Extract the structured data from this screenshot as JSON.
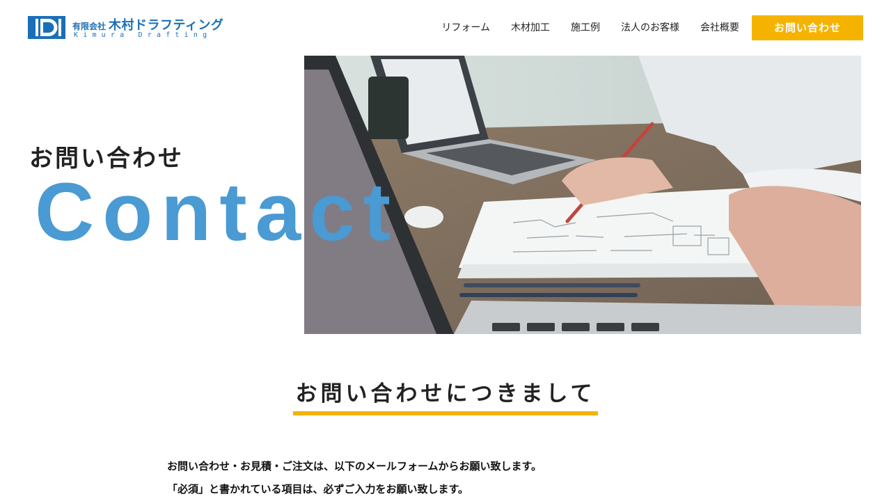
{
  "brand": {
    "company_prefix": "有限会社",
    "company_name": "木村ドラフティング",
    "company_en": "Kimura Drafting",
    "logo_icon": "kd-logo-mark",
    "color": "#1a6fb8"
  },
  "nav": {
    "items": [
      {
        "label": "リフォーム"
      },
      {
        "label": "木材加工"
      },
      {
        "label": "施工例"
      },
      {
        "label": "法人のお客様"
      },
      {
        "label": "会社概要"
      }
    ],
    "cta_label": "お問い合わせ"
  },
  "hero": {
    "subtitle": "お問い合わせ",
    "title": "Contact",
    "image": "office-desk-laptops-photo"
  },
  "section": {
    "title": "お問い合わせにつきまして",
    "lines": [
      "お問い合わせ・お見積・ご注文は、以下のメールフォームからお願い致します。",
      "「必須」と書かれている項目は、必ずご入力をお願い致します。"
    ]
  },
  "colors": {
    "accent": "#f5b300",
    "title_blue": "#4a9ad3",
    "text": "#222222"
  }
}
